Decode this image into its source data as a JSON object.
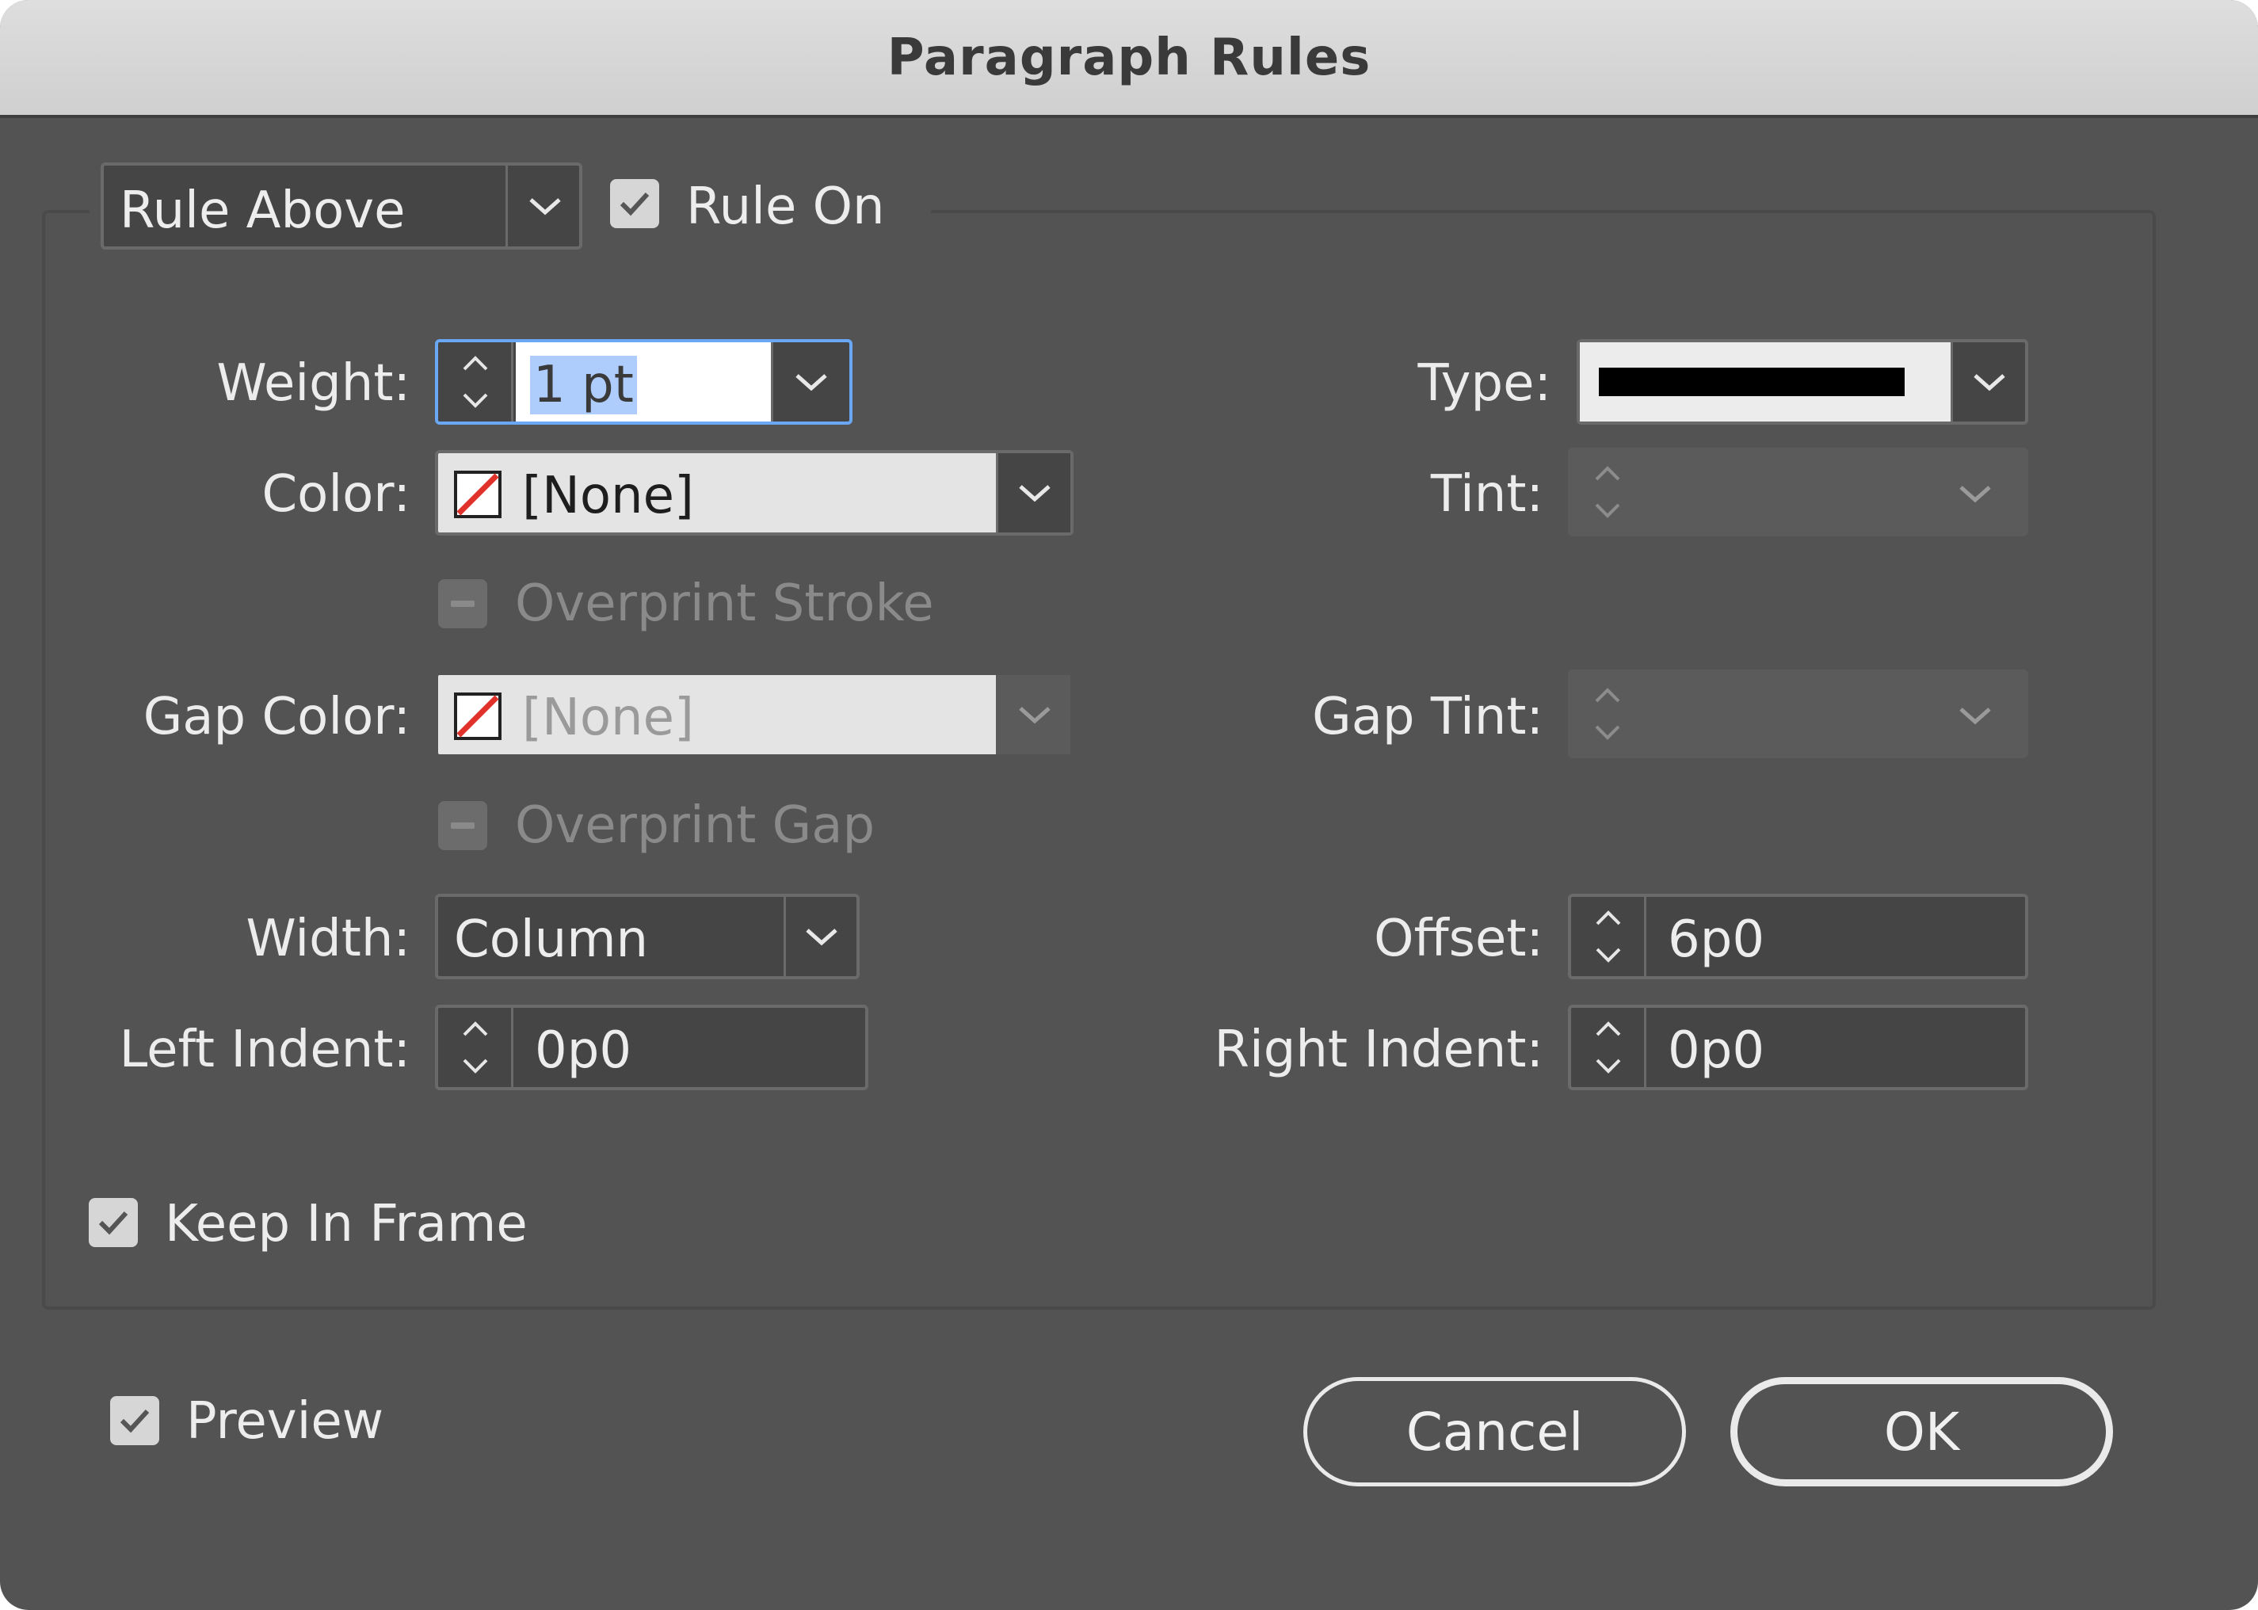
{
  "title": "Paragraph Rules",
  "rule_select": {
    "value": "Rule Above"
  },
  "rule_on": {
    "label": "Rule On",
    "checked": true
  },
  "weight": {
    "label": "Weight:",
    "value": "1 pt"
  },
  "type": {
    "label": "Type:",
    "swatch_color": "#000000"
  },
  "color": {
    "label": "Color:",
    "value": "[None]"
  },
  "tint": {
    "label": "Tint:",
    "value": ""
  },
  "overprint_stroke": {
    "label": "Overprint Stroke",
    "enabled": false
  },
  "gap_color": {
    "label": "Gap Color:",
    "value": "[None]",
    "enabled": false
  },
  "gap_tint": {
    "label": "Gap Tint:",
    "value": ""
  },
  "overprint_gap": {
    "label": "Overprint Gap",
    "enabled": false
  },
  "width": {
    "label": "Width:",
    "value": "Column"
  },
  "offset": {
    "label": "Offset:",
    "value": "6p0"
  },
  "left_indent": {
    "label": "Left Indent:",
    "value": "0p0"
  },
  "right_indent": {
    "label": "Right Indent:",
    "value": "0p0"
  },
  "keep_in_frame": {
    "label": "Keep In Frame",
    "checked": true
  },
  "preview": {
    "label": "Preview",
    "checked": true
  },
  "buttons": {
    "cancel": "Cancel",
    "ok": "OK"
  },
  "colors": {
    "background": "#535353",
    "titlebar": "#d6d6d6",
    "selection": "#aecdfd",
    "focus": "#6aa7f5",
    "none_slash": "#e0322b"
  }
}
